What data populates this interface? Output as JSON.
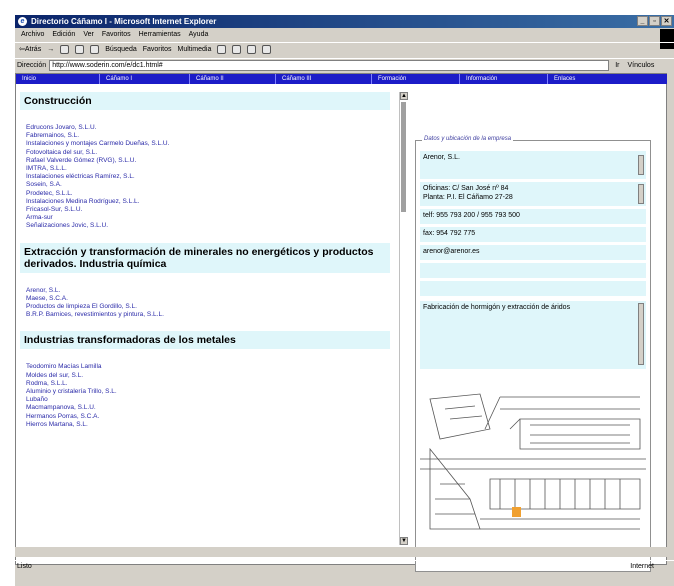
{
  "window": {
    "title": "Directorio Cáñamo I - Microsoft Internet Explorer"
  },
  "menu": [
    "Archivo",
    "Edición",
    "Ver",
    "Favoritos",
    "Herramientas",
    "Ayuda"
  ],
  "toolbar": {
    "back": "⇦Atrás",
    "search": "Búsqueda",
    "favorites": "Favoritos",
    "multimedia": "Multimedia"
  },
  "address": {
    "label": "Dirección",
    "url": "http://www.soderin.com/e/dc1.html#",
    "go": "Ir",
    "links": "Vínculos"
  },
  "nav": [
    "Inicio",
    "Cáñamo I",
    "Cáñamo II",
    "Cáñamo III",
    "Formación",
    "Información",
    "Enlaces"
  ],
  "sections": [
    {
      "title": "Construcción",
      "companies": [
        "Edrucons Jovaro, S.L.U.",
        "Fabremainos, S.L.",
        "Instalaciones y montajes Carmelo Dueñas, S.L.U.",
        "Fotovoltaica del sur, S.L.",
        "Rafael Valverde Gómez (RVG), S.L.U.",
        "IMTRA, S.L.L.",
        "Instalaciones eléctricas Ramírez, S.L.",
        "Sosein, S.A.",
        "Prodetec, S.L.L.",
        "Instalaciones Medina Rodríguez, S.L.L.",
        "Fricasol-Sur, S.L.U.",
        "Arma-sur",
        "Señalizaciones Jovic, S.L.U."
      ]
    },
    {
      "title": "Extracción y transformación de minerales no energéticos y productos derivados. Industria química",
      "companies": [
        "Arenor, S.L.",
        "Maese, S.C.A.",
        "Productos de limpieza El Gordillo, S.L.",
        "B.R.P. Barnices, revestimientos y pintura, S.L.L."
      ]
    },
    {
      "title": "Industrias transformadoras de los metales",
      "companies": [
        "Teodomiro Macías Lamilla",
        "Moldes del sur, S.L.",
        "Rodma, S.L.L.",
        "Aluminio y cristalería Trillo, S.L.",
        "Lubaño",
        "Macmampanova, S.L.U.",
        "Hermanos Porras, S.C.A.",
        "Hierros Martana, S.L."
      ]
    }
  ],
  "details": {
    "legend": "Datos y ubicación de la empresa",
    "name": "Arenor, S.L.",
    "address1": "Oficinas: C/ San José nº 84",
    "address2": "Planta: P.I. El Cáñamo 27-28",
    "phone": "telf: 955 793 200 / 955 793 500",
    "fax": "fax: 954 792 775",
    "email": "arenor@arenor.es",
    "activity": "Fabricación de hormigón y extracción de áridos"
  },
  "status": {
    "left": "Listo",
    "zone": "Internet"
  },
  "colors": {
    "accent": "#1c1cc8",
    "field_bg": "#dff6fa",
    "link": "#2a2aa8",
    "highlight": "#f0a030"
  }
}
